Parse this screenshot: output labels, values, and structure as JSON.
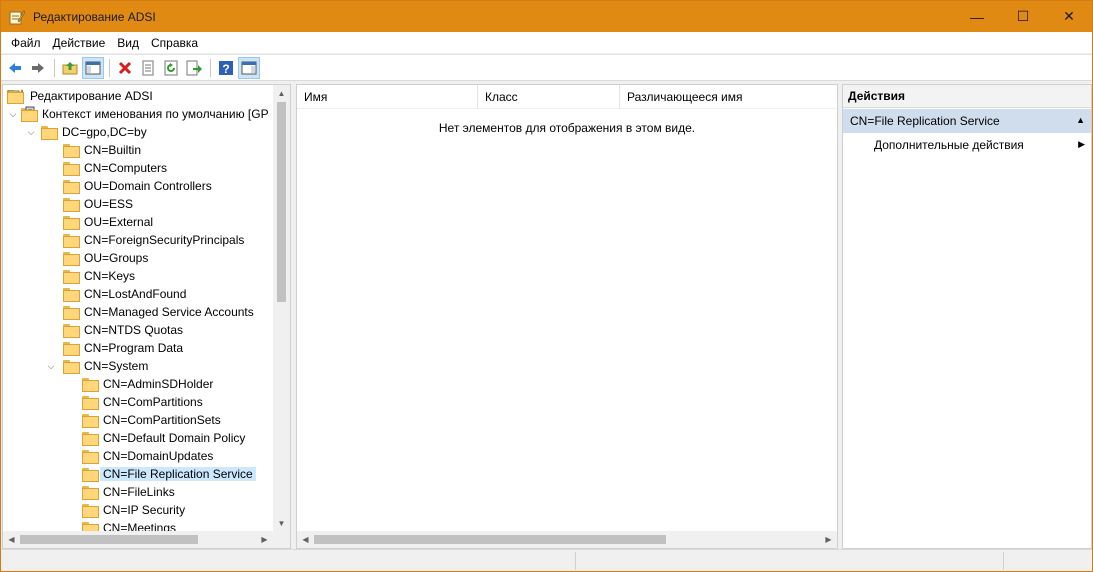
{
  "window": {
    "title": "Редактирование ADSI",
    "controls": {
      "minimize": "—",
      "maximize": "☐",
      "close": "✕"
    }
  },
  "menu": [
    {
      "label": "Файл"
    },
    {
      "label": "Действие"
    },
    {
      "label": "Вид"
    },
    {
      "label": "Справка"
    }
  ],
  "toolbar": {
    "buttons": [
      "back-icon",
      "forward-icon",
      "up-folder-icon",
      "show-hide-tree-icon",
      "delete-icon",
      "properties-icon",
      "refresh-icon",
      "export-list-icon",
      "help-icon",
      "show-hide-action-pane-icon"
    ]
  },
  "tree": {
    "root": "Редактирование ADSI",
    "context": "Контекст именования по умолчанию [GP",
    "domain": "DC=gpo,DC=by",
    "items": [
      "CN=Builtin",
      "CN=Computers",
      "OU=Domain Controllers",
      "OU=ESS",
      "OU=External",
      "CN=ForeignSecurityPrincipals",
      "OU=Groups",
      "CN=Keys",
      "CN=LostAndFound",
      "CN=Managed Service Accounts",
      "CN=NTDS Quotas",
      "CN=Program Data",
      "CN=System"
    ],
    "system_children": [
      "CN=AdminSDHolder",
      "CN=ComPartitions",
      "CN=ComPartitionSets",
      "CN=Default Domain Policy",
      "CN=DomainUpdates",
      "CN=File Replication Service",
      "CN=FileLinks",
      "CN=IP Security",
      "CN=Meetings"
    ],
    "selected": "CN=File Replication Service"
  },
  "list": {
    "columns": [
      "Имя",
      "Класс",
      "Различающееся имя"
    ],
    "empty_message": "Нет элементов для отображения в этом виде."
  },
  "actions": {
    "title": "Действия",
    "group": "CN=File Replication Service",
    "items": [
      {
        "label": "Дополнительные действия"
      }
    ]
  }
}
